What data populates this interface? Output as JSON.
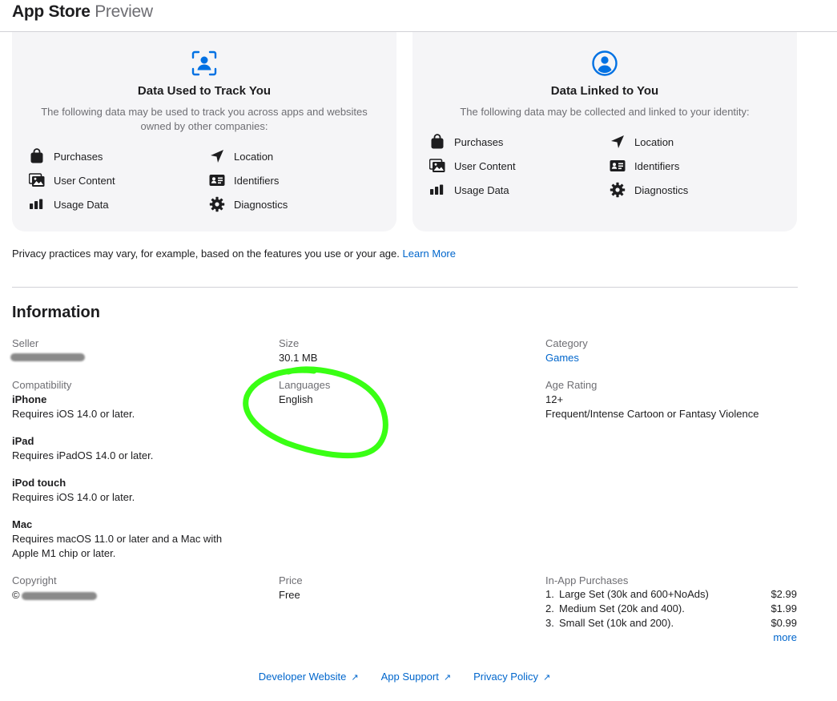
{
  "header": {
    "brand": "App Store",
    "sub": "Preview"
  },
  "cards": {
    "track": {
      "title": "Data Used to Track You",
      "desc": "The following data may be used to track you across apps and websites owned by other companies:",
      "items": [
        "Purchases",
        "Location",
        "User Content",
        "Identifiers",
        "Usage Data",
        "Diagnostics"
      ],
      "icons": [
        "shopping-bag-icon",
        "location-arrow-icon",
        "photo-icon",
        "id-card-icon",
        "bar-chart-icon",
        "gear-icon"
      ]
    },
    "linked": {
      "title": "Data Linked to You",
      "desc": "The following data may be collected and linked to your identity:",
      "items": [
        "Purchases",
        "Location",
        "User Content",
        "Identifiers",
        "Usage Data",
        "Diagnostics"
      ],
      "icons": [
        "shopping-bag-icon",
        "location-arrow-icon",
        "photo-icon",
        "id-card-icon",
        "bar-chart-icon",
        "gear-icon"
      ]
    }
  },
  "privacy_note": {
    "text": "Privacy practices may vary, for example, based on the features you use or your age.",
    "link": "Learn More"
  },
  "information": {
    "title": "Information",
    "seller": {
      "label": "Seller"
    },
    "size": {
      "label": "Size",
      "value": "30.1 MB"
    },
    "category": {
      "label": "Category",
      "value": "Games"
    },
    "compatibility": {
      "label": "Compatibility",
      "devices": [
        {
          "name": "iPhone",
          "req": "Requires iOS 14.0 or later."
        },
        {
          "name": "iPad",
          "req": "Requires iPadOS 14.0 or later."
        },
        {
          "name": "iPod touch",
          "req": "Requires iOS 14.0 or later."
        },
        {
          "name": "Mac",
          "req1": "Requires macOS 11.0 or later and a Mac with",
          "req2": "Apple M1 chip or later."
        }
      ]
    },
    "languages": {
      "label": "Languages",
      "value": "English"
    },
    "age_rating": {
      "label": "Age Rating",
      "value": "12+",
      "detail": "Frequent/Intense Cartoon or Fantasy Violence"
    },
    "copyright": {
      "label": "Copyright",
      "value": "©"
    },
    "price": {
      "label": "Price",
      "value": "Free"
    },
    "in_app": {
      "label": "In-App Purchases",
      "items": [
        {
          "num": "1.",
          "name": "Large Set (30k and 600+NoAds)",
          "price": "$2.99"
        },
        {
          "num": "2.",
          "name": "Medium Set (20k and 400).",
          "price": "$1.99"
        },
        {
          "num": "3.",
          "name": "Small Set (10k and 200).",
          "price": "$0.99"
        }
      ],
      "more": "more"
    }
  },
  "footer": {
    "developer": "Developer Website",
    "support": "App Support",
    "policy": "Privacy Policy",
    "arrow": "↗"
  },
  "colors": {
    "link": "#0066cc",
    "card_bg": "#f5f5f7",
    "accent_icon": "#0071e3",
    "annotation": "#39ff14"
  }
}
